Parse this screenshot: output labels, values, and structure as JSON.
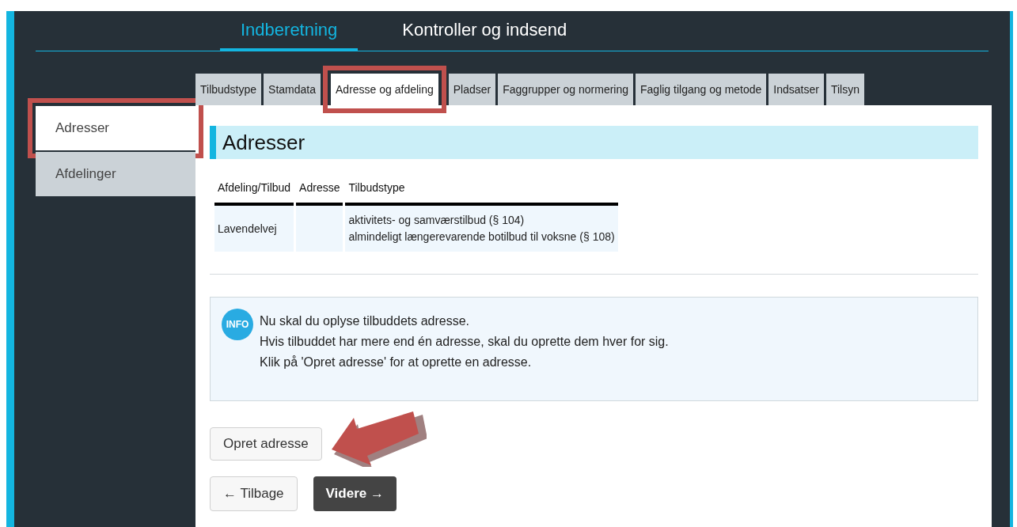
{
  "top_nav": [
    {
      "label": "Indberetning",
      "selected": true
    },
    {
      "label": "Kontroller og indsend",
      "selected": false
    }
  ],
  "tabs": [
    {
      "label": "Tilbudstype",
      "selected": false,
      "highlighted": false
    },
    {
      "label": "Stamdata",
      "selected": false,
      "highlighted": false
    },
    {
      "label": "Adresse og afdeling",
      "selected": true,
      "highlighted": true
    },
    {
      "label": "Pladser",
      "selected": false,
      "highlighted": false
    },
    {
      "label": "Faggrupper og normering",
      "selected": false,
      "highlighted": false
    },
    {
      "label": "Faglig tilgang og metode",
      "selected": false,
      "highlighted": false
    },
    {
      "label": "Indsatser",
      "selected": false,
      "highlighted": false
    },
    {
      "label": "Tilsyn",
      "selected": false,
      "highlighted": false
    }
  ],
  "sidebar": {
    "items": [
      {
        "label": "Adresser",
        "selected": true,
        "highlighted": true
      },
      {
        "label": "Afdelinger",
        "selected": false,
        "highlighted": false
      }
    ]
  },
  "heading": "Adresser",
  "table": {
    "columns": [
      "Afdeling/Tilbud",
      "Adresse",
      "Tilbudstype"
    ],
    "rows": [
      {
        "cells": [
          [
            "Lavendelvej"
          ],
          [],
          [
            "aktivitets- og samværstilbud (§ 104)",
            "almindeligt længerevarende botilbud til voksne (§ 108)"
          ]
        ]
      }
    ]
  },
  "info": {
    "badge": "INFO",
    "lines": [
      "Nu skal du oplyse tilbuddets adresse.",
      "Hvis tilbuddet har mere end én adresse, skal du oprette dem hver for sig.",
      "Klik på 'Opret adresse' for at oprette en adresse."
    ]
  },
  "create_button": {
    "label": "Opret adresse",
    "pointed_at": true
  },
  "nav_buttons": [
    {
      "label": "← Tilbage",
      "kind": "secondary"
    },
    {
      "label": "Videre →",
      "kind": "primary"
    }
  ]
}
